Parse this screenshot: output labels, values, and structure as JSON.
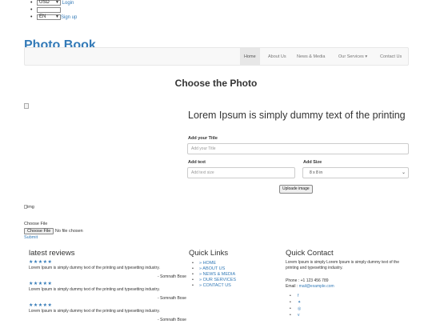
{
  "header": {
    "currency": "USD",
    "login": "Login",
    "language": "EN",
    "signup": "Sign up",
    "brand": "Photo Book"
  },
  "nav": {
    "items": [
      "Home",
      "About Us",
      "News & Media",
      "Our Services ▾",
      "Contact Us"
    ]
  },
  "main": {
    "title": "Choose the Photo",
    "lorem_heading": "Lorem Ipsum is simply dummy text of the printing",
    "add_title_label": "Add your Title",
    "add_title_placeholder": "Add your Title",
    "add_text_label": "Add text",
    "add_text_placeholder": "Add text size",
    "add_size_label": "Add Size",
    "size_selected": "8 x 8 in",
    "upload_button": "Uploade image",
    "img_alt": "img",
    "choose_file_label": "Choose File",
    "file_button": "Choose File",
    "file_status": "No file chosen",
    "submit": "Submit"
  },
  "footer": {
    "reviews_title": "latest reviews",
    "reviews": [
      {
        "stars": "★★★★★",
        "text": "Lorem Ipsum is simply dummy text of the printing and typesetting industry.",
        "author": "- Somnath Bose"
      },
      {
        "stars": "★★★★★",
        "text": "Lorem Ipsum is simply dummy text of the printing and typesetting industry.",
        "author": "- Somnath Bose"
      },
      {
        "stars": "★★★★★",
        "text": "Lorem Ipsum is simply dummy text of the printing and typesetting industry.",
        "author": "- Somnath Bose"
      }
    ],
    "links_title": "Quick Links",
    "links": [
      "» HOME",
      "» ABOUT US",
      "» NEWS & MEDIA",
      "» OUR SERVICES",
      "» CONTACT US"
    ],
    "contact_title": "Quick Contact",
    "contact_text": "Lorem Ipsum is simply Lorem Ipsum is simply dummy text of the printing and typesetting industry.",
    "phone": "Phone : +1 123 456 789",
    "email_label": "Email : ",
    "email": "mail@example.com",
    "social": [
      "f",
      "✦",
      "◎",
      "v"
    ]
  },
  "icons": {
    "social": [
      "facebook-icon",
      "twitter-icon",
      "dribbble-icon",
      "vimeo-icon"
    ]
  }
}
